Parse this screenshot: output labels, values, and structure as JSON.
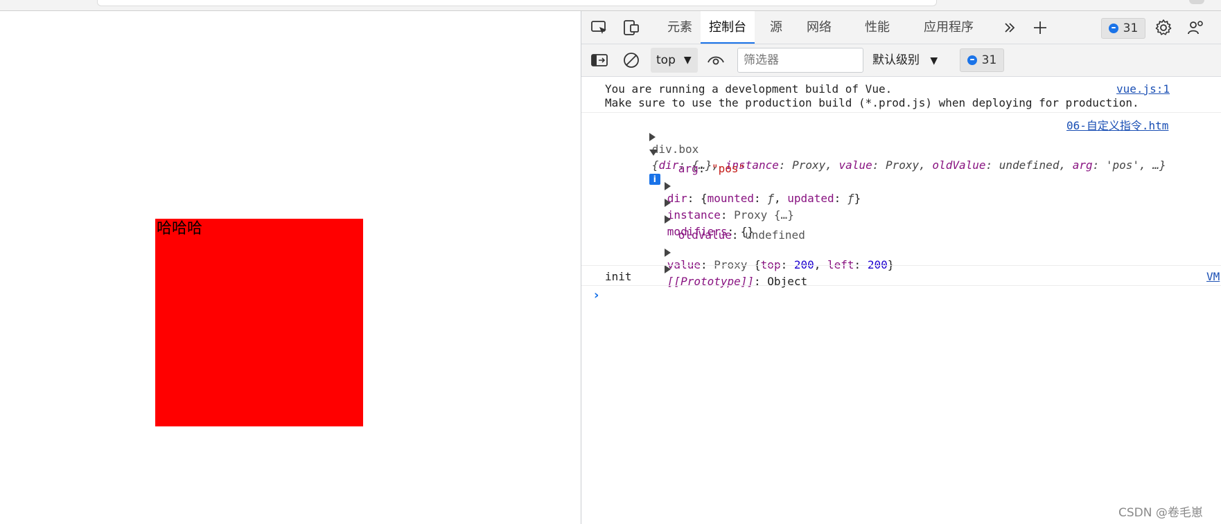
{
  "page": {
    "box_text": "哈哈哈"
  },
  "devtools": {
    "tabs": [
      {
        "label": "元素"
      },
      {
        "label": "控制台"
      },
      {
        "label": "源"
      },
      {
        "label": "网络"
      },
      {
        "label": "性能"
      },
      {
        "label": "应用程序"
      }
    ],
    "issues_count": "31",
    "toolbar": {
      "context": "top",
      "filter_placeholder": "筛选器",
      "level": "默认级别",
      "issues_count": "31"
    },
    "console": {
      "vue_warning_line1": "You are running a development build of Vue.",
      "vue_warning_line2": "Make sure to use the production build (*.prod.js) when deploying for production.",
      "vue_source": "vue.js:1",
      "divbox_label": "div.box",
      "divbox_source": "06-自定义指令.htm",
      "obj_summary": {
        "k1": "dir",
        "v1": "{…}",
        "k2": "instance",
        "v2": "Proxy",
        "k3": "value",
        "v3": "Proxy",
        "k4": "oldValue",
        "v4": "undefined",
        "k5": "arg",
        "v5": "'pos'",
        "tail": ", …}"
      },
      "props": {
        "arg_key": "arg",
        "arg_val": "\"pos\"",
        "dir_key": "dir",
        "dir_m": "mounted",
        "dir_u": "updated",
        "fn": "ƒ",
        "instance_key": "instance",
        "instance_val": "Proxy {…}",
        "modifiers_key": "modifiers",
        "modifiers_val": "{}",
        "oldvalue_key": "oldValue",
        "oldvalue_val": "undefined",
        "value_key": "value",
        "value_proxy": "Proxy",
        "top_key": "top",
        "top_val": "200",
        "left_key": "left",
        "left_val": "200",
        "proto_key": "[[Prototype]]",
        "proto_val": "Object"
      },
      "init_text": "init",
      "init_source": "VM"
    }
  },
  "watermark": "CSDN @卷毛崽"
}
